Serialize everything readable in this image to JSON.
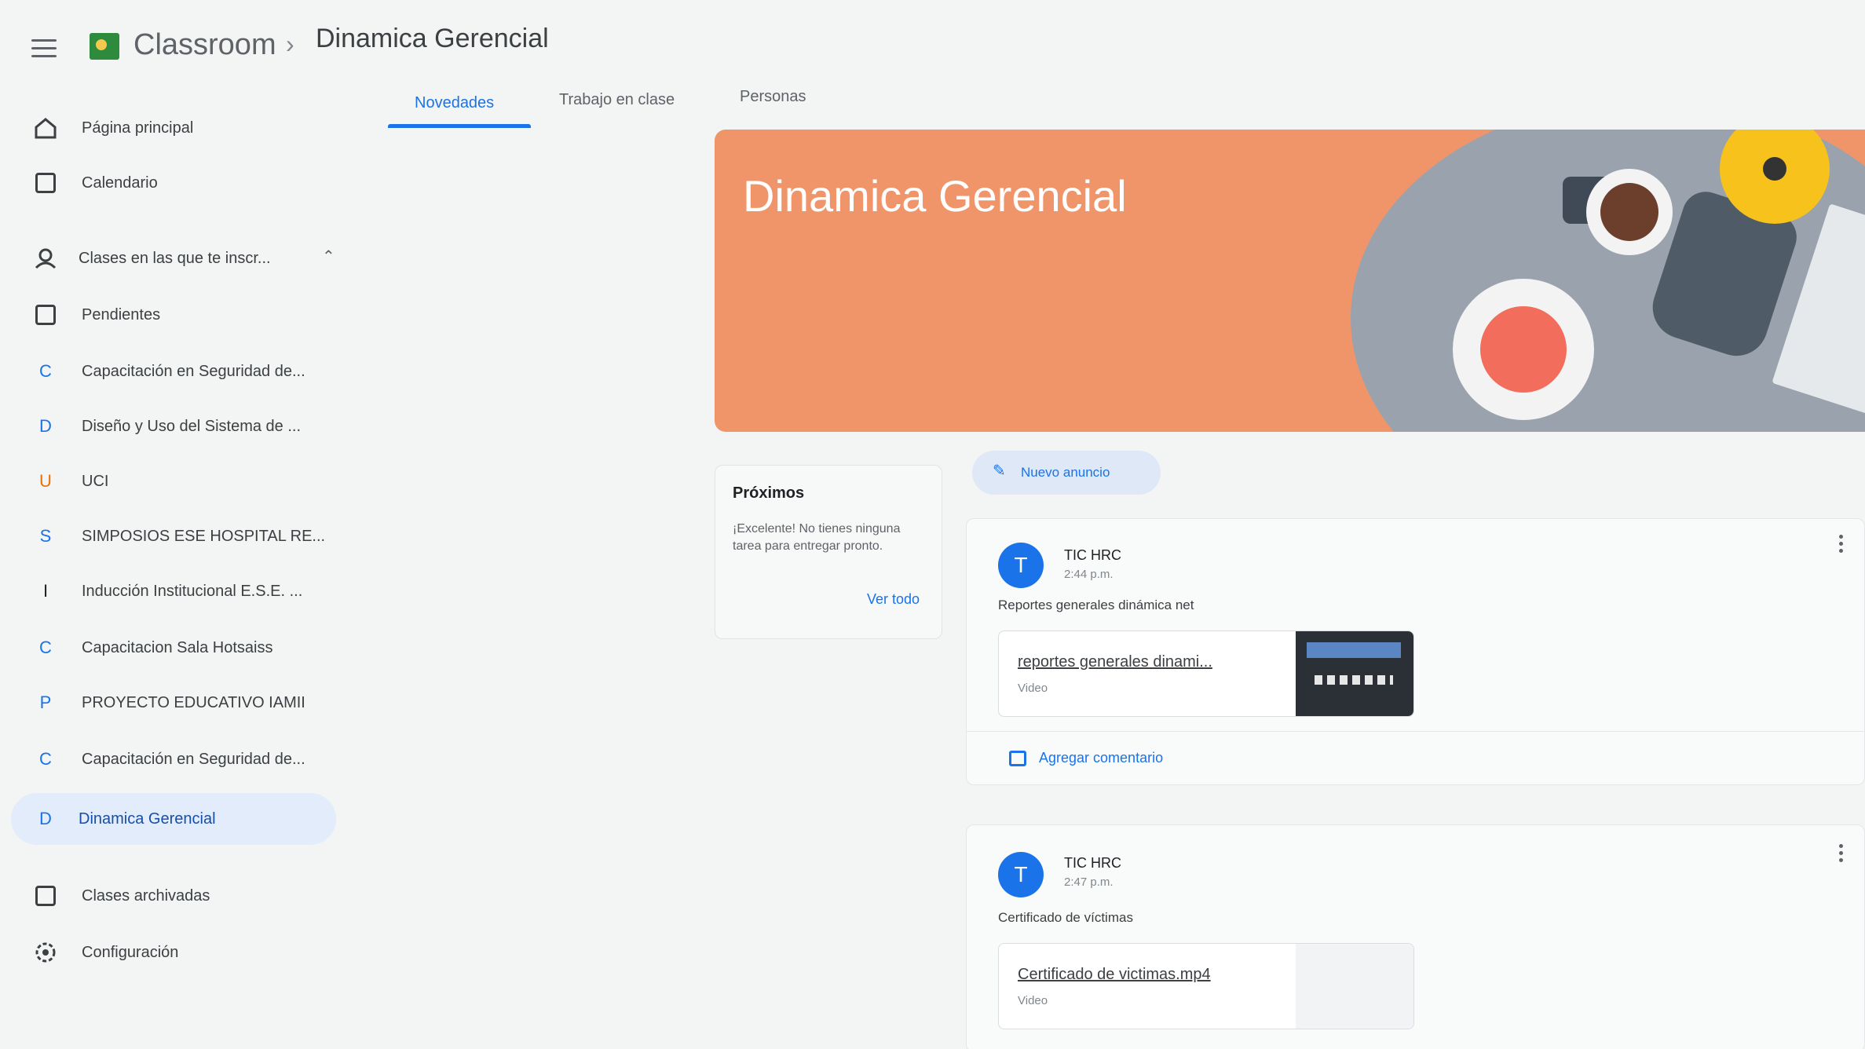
{
  "header": {
    "app_name": "Classroom",
    "breadcrumb_separator": "›",
    "class_name": "Dinamica Gerencial"
  },
  "tabs": [
    {
      "label": "Novedades",
      "active": true
    },
    {
      "label": "Trabajo en clase",
      "active": false
    },
    {
      "label": "Personas",
      "active": false
    }
  ],
  "sidebar": {
    "items": [
      {
        "icon": "home-icon",
        "label": "Página principal"
      },
      {
        "icon": "calendar-icon",
        "label": "Calendario"
      },
      {
        "icon": "enrolled-classes-icon",
        "label": "Clases en las que te inscr..."
      },
      {
        "icon": "todo-icon",
        "label": "Pendientes"
      },
      {
        "icon": "C",
        "label": "Capacitación en Seguridad de..."
      },
      {
        "icon": "D",
        "label": "Diseño y Uso del Sistema de ..."
      },
      {
        "icon": "U",
        "label": "UCI"
      },
      {
        "icon": "S",
        "label": "SIMPOSIOS ESE HOSPITAL RE..."
      },
      {
        "icon": "I",
        "label": "Inducción Institucional E.S.E. ..."
      },
      {
        "icon": "C",
        "label": "Capacitacion Sala Hotsaiss"
      },
      {
        "icon": "P",
        "label": "PROYECTO EDUCATIVO IAMII"
      },
      {
        "icon": "C",
        "label": "Capacitación en Seguridad de..."
      },
      {
        "icon": "D",
        "label": "Dinamica Gerencial"
      },
      {
        "icon": "archive-icon",
        "label": "Clases archivadas"
      },
      {
        "icon": "settings-icon",
        "label": "Configuración"
      }
    ]
  },
  "banner": {
    "title": "Dinamica Gerencial",
    "color": "#f0956a"
  },
  "upcoming": {
    "title": "Próximos",
    "text": "¡Excelente! No tienes ninguna tarea para entregar pronto.",
    "link": "Ver todo"
  },
  "new_announcement": {
    "label": "Nuevo anuncio"
  },
  "posts": [
    {
      "avatar": "T",
      "author": "TIC HRC",
      "time": "2:44 p.m.",
      "text": "Reportes generales dinámica net",
      "attachment_name": "reportes generales dinami...",
      "attachment_type": "Video",
      "comment": "Agregar comentario"
    },
    {
      "avatar": "T",
      "author": "TIC HRC",
      "time": "2:47 p.m.",
      "text": "Certificado de víctimas",
      "attachment_name": "Certificado de victimas.mp4",
      "attachment_type": "Video"
    }
  ],
  "colors": {
    "accent": "#1a73e8",
    "active_nav_bg": "#e3ecfb",
    "brand_green": "#2e8b3d"
  }
}
